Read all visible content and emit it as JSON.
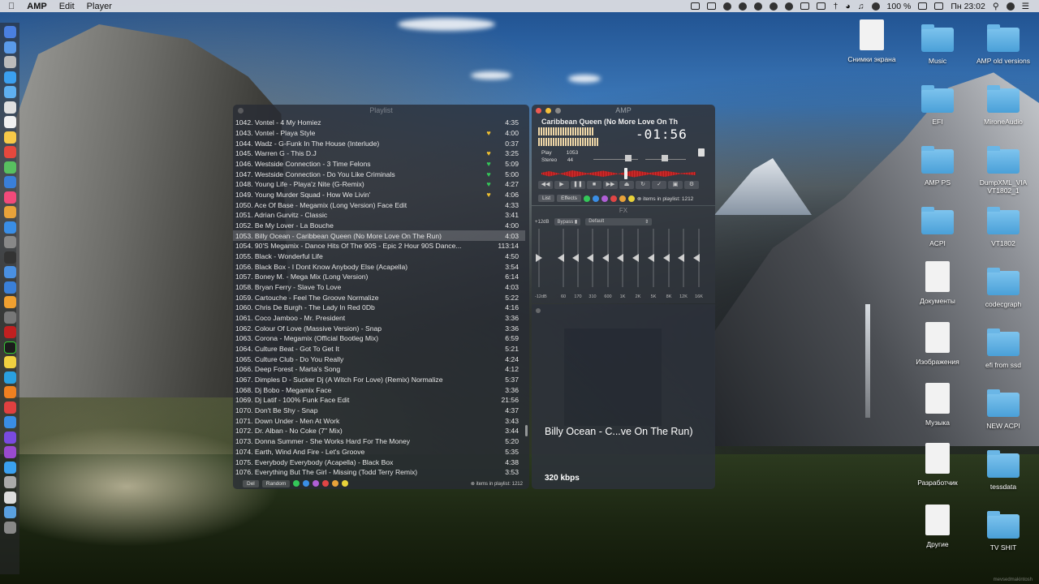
{
  "menubar": {
    "app_name": "AMP",
    "menus": [
      "Edit",
      "Player"
    ],
    "battery": "100 %",
    "day_time": "Пн 23:02"
  },
  "desktop": {
    "items": [
      {
        "label": "Снимки экрана",
        "kind": "doc"
      },
      {
        "label": "Music",
        "kind": "folder"
      },
      {
        "label": "AMP old versions",
        "kind": "folder"
      },
      {
        "label": "EFI",
        "kind": "folder"
      },
      {
        "label": "MironeAudio",
        "kind": "folder"
      },
      {
        "label": "AMP PS",
        "kind": "folder"
      },
      {
        "label": "DumpXML_VIA VT1802_1",
        "kind": "folder"
      },
      {
        "label": "ACPI",
        "kind": "folder"
      },
      {
        "label": "VT1802",
        "kind": "folder"
      },
      {
        "label": "Документы",
        "kind": "doc"
      },
      {
        "label": "codecgraph",
        "kind": "folder"
      },
      {
        "label": "Изображения",
        "kind": "doc"
      },
      {
        "label": "efi from ssd",
        "kind": "folder"
      },
      {
        "label": "Музыка",
        "kind": "doc"
      },
      {
        "label": "NEW ACPI",
        "kind": "folder"
      },
      {
        "label": "Разработчик",
        "kind": "doc"
      },
      {
        "label": "tessdata",
        "kind": "folder"
      },
      {
        "label": "Другие",
        "kind": "doc"
      },
      {
        "label": "TV SHIT",
        "kind": "folder"
      }
    ]
  },
  "playlist": {
    "title": "Playlist",
    "tracks": [
      {
        "name": "1042. Vontel - 4 My Homiez",
        "heart": "",
        "dur": "4:35"
      },
      {
        "name": "1043. Vontel - Playa Style",
        "heart": "yellow",
        "dur": "4:00"
      },
      {
        "name": "1044. Wadz - G-Funk In The House (Interlude)",
        "heart": "",
        "dur": "0:37"
      },
      {
        "name": "1045. Warren G - This D.J",
        "heart": "yellow",
        "dur": "3:25"
      },
      {
        "name": "1046. Westside Connection - 3 Time Felons",
        "heart": "green",
        "dur": "5:09"
      },
      {
        "name": "1047. Westside Connection - Do You Like Criminals",
        "heart": "green",
        "dur": "5:00"
      },
      {
        "name": "1048. Young Life - Playa'z Nite (G-Remix)",
        "heart": "green",
        "dur": "4:27"
      },
      {
        "name": "1049. Young Murder Squad - How We Livin'",
        "heart": "yellow",
        "dur": "4:06"
      },
      {
        "name": "1050. Ace Of Base - Megamix (Long Version) Face Edit",
        "heart": "",
        "dur": "4:33"
      },
      {
        "name": "1051. Adrian Gurvitz - Classic",
        "heart": "",
        "dur": "3:41"
      },
      {
        "name": "1052. Be My Lover - La Bouche",
        "heart": "",
        "dur": "4:00"
      },
      {
        "name": "1053. Billy Ocean - Caribbean Queen (No More Love On The Run)",
        "heart": "",
        "dur": "4:03",
        "active": true
      },
      {
        "name": "1054. 90'S Megamix - Dance Hits Of The 90S - Epic 2 Hour 90S Dance...",
        "heart": "",
        "dur": "113:14"
      },
      {
        "name": "1055. Black - Wonderful Life",
        "heart": "",
        "dur": "4:50"
      },
      {
        "name": "1056. Black Box - I Dont Know Anybody Else (Acapella)",
        "heart": "",
        "dur": "3:54"
      },
      {
        "name": "1057. Boney M. - Mega Mix (Long Version)",
        "heart": "",
        "dur": "6:14"
      },
      {
        "name": "1058. Bryan Ferry - Slave To Love",
        "heart": "",
        "dur": "4:03"
      },
      {
        "name": "1059. Cartouche - Feel The Groove Normalize",
        "heart": "",
        "dur": "5:22"
      },
      {
        "name": "1060. Chris De Burgh - The Lady In Red 0Db",
        "heart": "",
        "dur": "4:16"
      },
      {
        "name": "1061. Coco Jamboo - Mr. President",
        "heart": "",
        "dur": "3:36"
      },
      {
        "name": "1062. Colour Of Love (Massive Version) - Snap",
        "heart": "",
        "dur": "3:36"
      },
      {
        "name": "1063. Corona - Megamix (Official Bootleg Mix)",
        "heart": "",
        "dur": "6:59"
      },
      {
        "name": "1064. Culture Beat - Got To Get It",
        "heart": "",
        "dur": "5:21"
      },
      {
        "name": "1065. Culture Club - Do You Really",
        "heart": "",
        "dur": "4:24"
      },
      {
        "name": "1066. Deep Forest - Marta's Song",
        "heart": "",
        "dur": "4:12"
      },
      {
        "name": "1067. Dimples D - Sucker Dj (A Witch For Love) (Remix) Normalize",
        "heart": "",
        "dur": "5:37"
      },
      {
        "name": "1068. Dj Bobo - Megamix Face",
        "heart": "",
        "dur": "3:36"
      },
      {
        "name": "1069. Dj Latif - 100% Funk Face Edit",
        "heart": "",
        "dur": "21:56"
      },
      {
        "name": "1070. Don't Be Shy - Snap",
        "heart": "",
        "dur": "4:37"
      },
      {
        "name": "1071. Down Under - Men At Work",
        "heart": "",
        "dur": "3:43"
      },
      {
        "name": "1072. Dr. Alban - No Coke (7'' Mix)",
        "heart": "",
        "dur": "3:44"
      },
      {
        "name": "1073. Donna Summer - She Works Hard For The Money",
        "heart": "",
        "dur": "5:20"
      },
      {
        "name": "1074. Earth, Wind And Fire - Let's Groove",
        "heart": "",
        "dur": "5:35"
      },
      {
        "name": "1075. Everybody Everybody (Acapella) - Black Box",
        "heart": "",
        "dur": "4:38"
      },
      {
        "name": "1076. Everything But The Girl - Missing (Todd Terry Remix)",
        "heart": "",
        "dur": "3:53"
      }
    ],
    "buttons": {
      "del": "Del",
      "random": "Random"
    },
    "count_text": "items in playlist: 1212",
    "color_dots": [
      "#34c759",
      "#3a8ee6",
      "#b05fd6",
      "#e04545",
      "#e8a23a",
      "#e8d23a"
    ]
  },
  "player": {
    "window_title": "AMP",
    "track_title": "Caribbean Queen (No More Love On Th",
    "time": "-01:56",
    "play_label": "Play",
    "play_value": "1053",
    "stereo_label": "Stereo",
    "stereo_value": "44",
    "tabs": {
      "list": "List",
      "effects": "Effects"
    },
    "count_text": "items in playlist: 1212",
    "color_dots": [
      "#34c759",
      "#3a8ee6",
      "#b05fd6",
      "#e04545",
      "#e8a23a",
      "#e8d23a"
    ]
  },
  "fx": {
    "title": "FX",
    "gain_top": "+12dB",
    "bypass": "Bypass",
    "preset": "Default",
    "gain_bottom": "-12dB",
    "bands": [
      "60",
      "170",
      "310",
      "600",
      "1K",
      "2K",
      "5K",
      "8K",
      "12K",
      "16K"
    ]
  },
  "art": {
    "now_playing": "Billy Ocean - C...ve On The Run)",
    "bitrate": "320 kbps"
  },
  "watermark": "mevsedmakintosh"
}
